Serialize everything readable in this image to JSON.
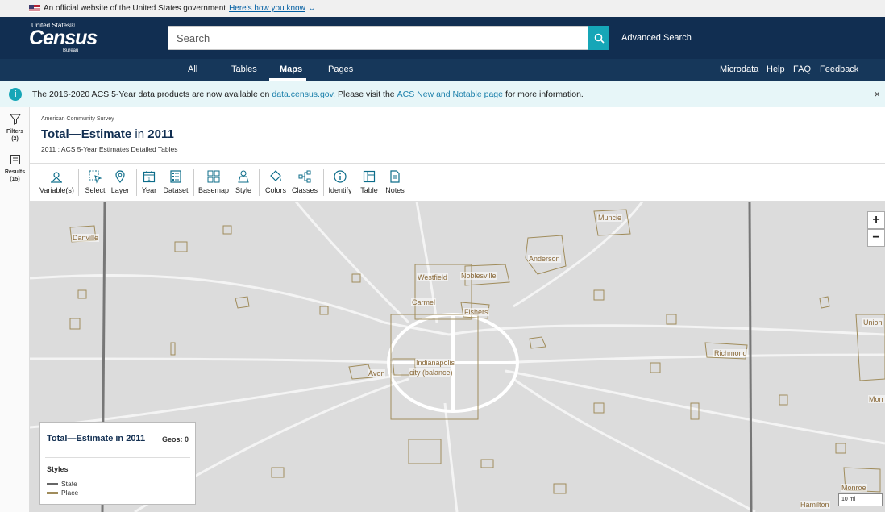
{
  "gov_banner": {
    "text": "An official website of the United States government",
    "link": "Here's how you know",
    "chevron": "⌄"
  },
  "header": {
    "logo_top": "United States®",
    "logo_main": "Census",
    "logo_bottom": "Bureau",
    "search_placeholder": "Search",
    "advanced_search": "Advanced Search"
  },
  "nav": {
    "tabs": [
      "All",
      "Tables",
      "Maps",
      "Pages"
    ],
    "active_tab": "Maps",
    "right_links": [
      "Microdata",
      "Help",
      "FAQ",
      "Feedback"
    ]
  },
  "notice": {
    "text_before": "The 2016-2020 ACS 5-Year data products are now available on",
    "link1": "data.census.gov.",
    "text_middle": "Please visit the",
    "link2": "ACS New and Notable page",
    "text_after": "for more information.",
    "close": "×"
  },
  "rail": {
    "filters_label": "Filters",
    "filters_count": "(2)",
    "results_label": "Results",
    "results_count": "(15)"
  },
  "title_area": {
    "survey": "American Community Survey",
    "title_main": "Total—Estimate",
    "title_in": " in ",
    "title_year": "2011",
    "subtitle": "2011 : ACS 5-Year Estimates Detailed Tables"
  },
  "toolbar": {
    "variables": "Variable(s)",
    "select": "Select",
    "layer": "Layer",
    "year": "Year",
    "dataset": "Dataset",
    "basemap": "Basemap",
    "style": "Style",
    "colors": "Colors",
    "classes": "Classes",
    "identify": "Identify",
    "table": "Table",
    "notes": "Notes"
  },
  "map": {
    "cities": [
      "Danville",
      "Muncie",
      "Anderson",
      "Westfield",
      "Noblesville",
      "Carmel",
      "Fishers",
      "Indianapolis",
      "city (balance)",
      "Avon",
      "Richmond",
      "Union",
      "Morr",
      "Monroe",
      "Hamilton"
    ],
    "zoom_in": "+",
    "zoom_out": "−",
    "scale": "10 mi"
  },
  "legend": {
    "title": "Total—Estimate in 2011",
    "geos": "Geos: 0",
    "styles": "Styles",
    "items": [
      {
        "label": "State",
        "color": "#666666"
      },
      {
        "label": "Place",
        "color": "#a08c5b"
      }
    ]
  },
  "colors": {
    "header": "#112e51",
    "accent": "#16a6b7",
    "place_outline": "#a08c5b"
  }
}
